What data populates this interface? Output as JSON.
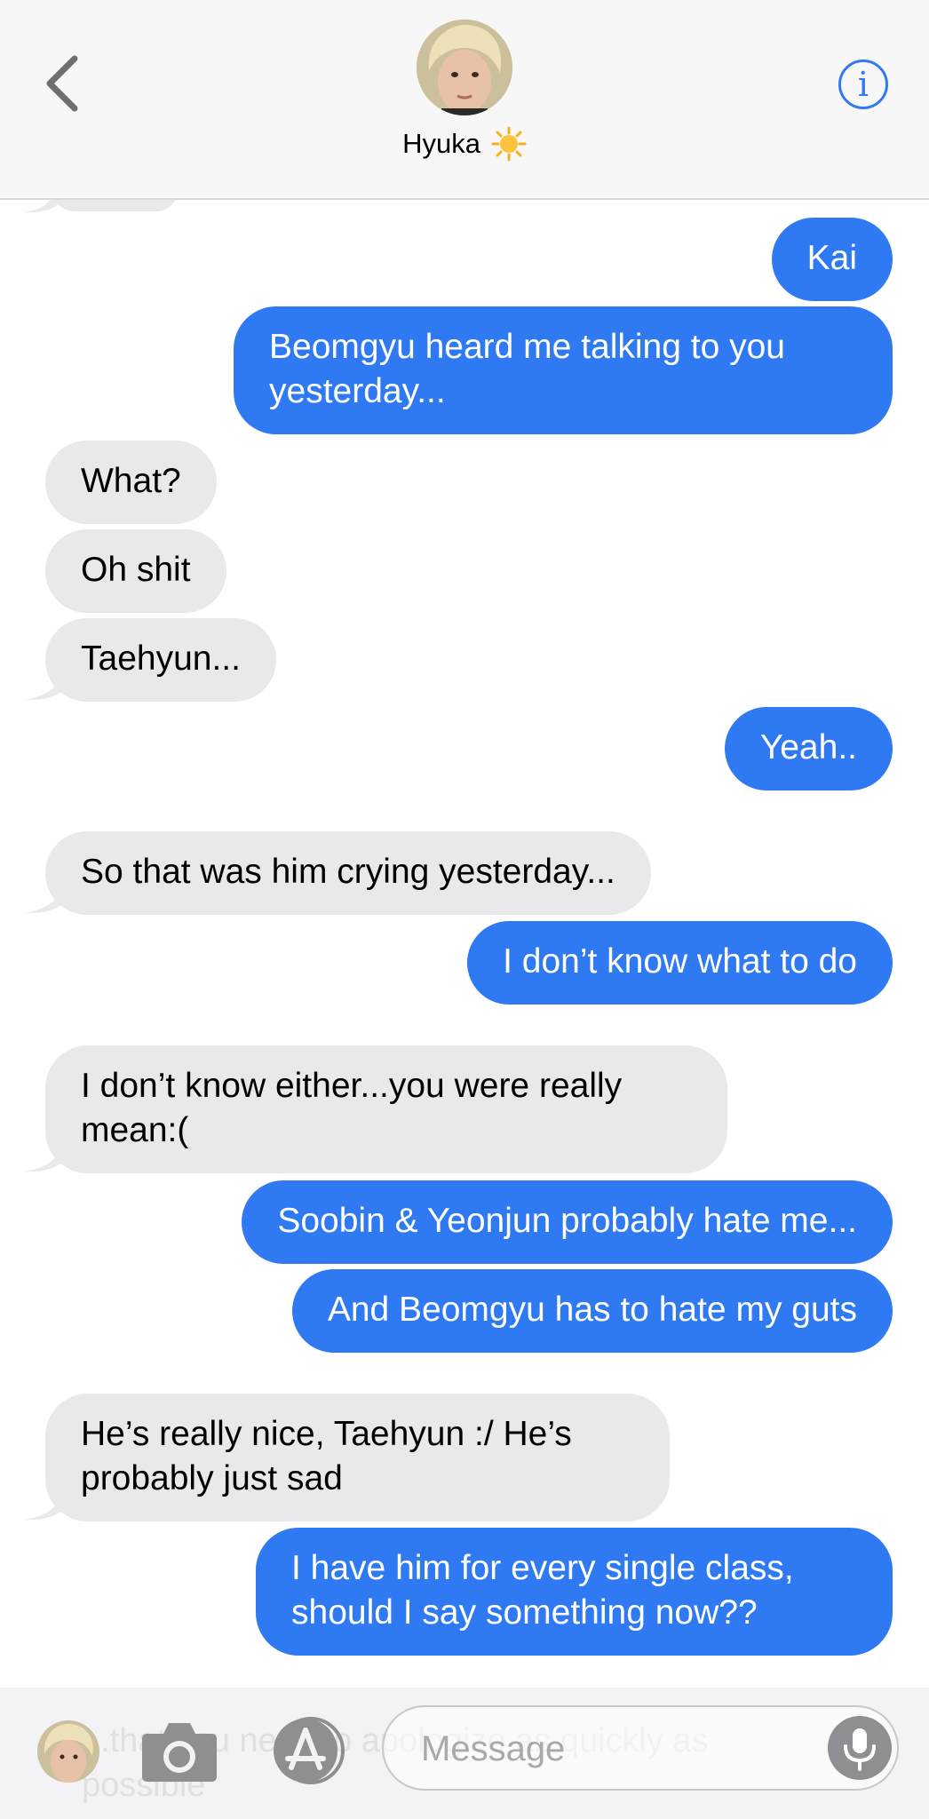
{
  "header": {
    "contact_name": "Hyuka",
    "info_label": "i"
  },
  "messages": [
    {
      "direction": "sent",
      "text": "Kai"
    },
    {
      "direction": "sent",
      "text": "Beomgyu heard me talking to you yesterday..."
    },
    {
      "direction": "received",
      "text": "What?"
    },
    {
      "direction": "received",
      "text": "Oh shit"
    },
    {
      "direction": "received",
      "text": "Taehyun..."
    },
    {
      "direction": "sent",
      "text": "Yeah.."
    },
    {
      "direction": "received",
      "text": "So that was him crying yesterday..."
    },
    {
      "direction": "sent",
      "text": "I don’t know what to do"
    },
    {
      "direction": "received",
      "text": "I don’t know either...you were really mean:("
    },
    {
      "direction": "sent",
      "text": "Soobin & Yeonjun probably hate me..."
    },
    {
      "direction": "sent",
      "text": "And Beomgyu has to hate my guts"
    },
    {
      "direction": "received",
      "text": "He’s really nice, Taehyun :/ He’s probably just sad"
    },
    {
      "direction": "sent",
      "text": "I have him for every single class, should I say something now??"
    }
  ],
  "composer": {
    "placeholder": "Message",
    "ghost_text": "...that you need to apologize as quickly as possible"
  },
  "colors": {
    "sent_bubble": "#2f7af3",
    "received_bubble": "#e9e9eb",
    "accent": "#2f7af3"
  },
  "icons": [
    "back-chevron-icon",
    "info-icon",
    "sun-emoji-icon",
    "camera-icon",
    "app-store-icon",
    "microphone-icon"
  ]
}
